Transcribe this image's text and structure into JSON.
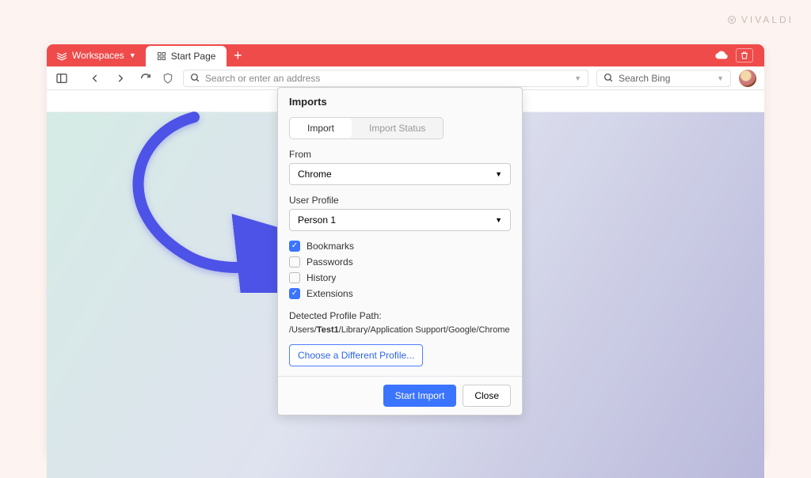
{
  "watermark": "VIVALDI",
  "tabstrip": {
    "workspaces": "Workspaces",
    "tab_title": "Start Page"
  },
  "addressbar": {
    "placeholder": "Search or enter an address",
    "search_placeholder": "Search Bing"
  },
  "dialog": {
    "title": "Imports",
    "tab_import": "Import",
    "tab_status": "Import Status",
    "from_label": "From",
    "from_value": "Chrome",
    "profile_label": "User Profile",
    "profile_value": "Person 1",
    "checks": [
      {
        "label": "Bookmarks",
        "checked": true
      },
      {
        "label": "Passwords",
        "checked": false
      },
      {
        "label": "History",
        "checked": false
      },
      {
        "label": "Extensions",
        "checked": true
      }
    ],
    "path_label": "Detected Profile Path:",
    "path_pre": "/Users/",
    "path_bold": "Test1",
    "path_post": "/Library/Application Support/Google/Chrome",
    "alt_button": "Choose a Different Profile...",
    "start": "Start Import",
    "close": "Close"
  }
}
